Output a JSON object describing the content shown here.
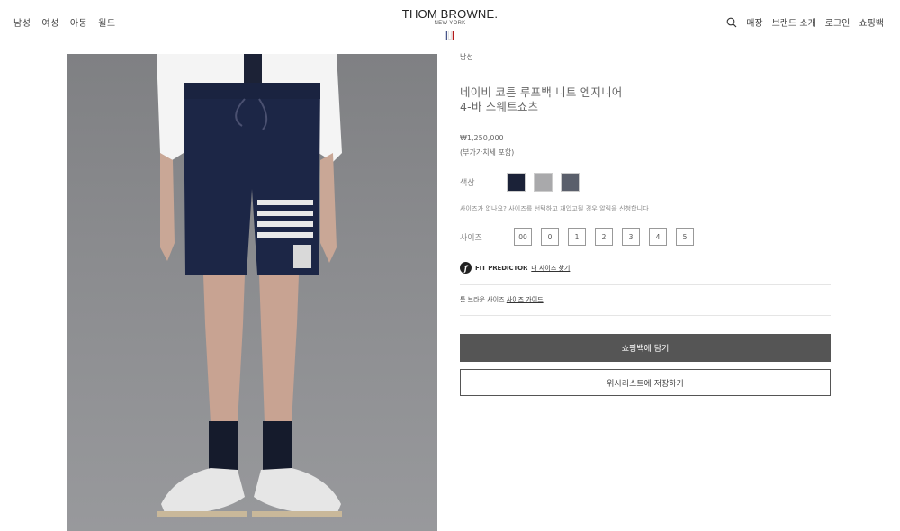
{
  "nav_left": [
    "남성",
    "여성",
    "아동",
    "월드"
  ],
  "logo": {
    "main": "THOM BROWNE.",
    "sub": "NEW YORK"
  },
  "flag_colors": [
    "#1a2a6c",
    "#ffffff",
    "#b31b1b"
  ],
  "nav_right": {
    "search_icon": "search-icon",
    "store": "매장",
    "brand": "브랜드 소개",
    "login": "로그인",
    "bag": "쇼핑백"
  },
  "product": {
    "category": "남성",
    "title": "네이비 코튼 루프백 니트 엔지니어 4-바 스웨트쇼츠",
    "price": "₩1,250,000",
    "vat": "(부가가치세 포함)",
    "color_label": "색상",
    "colors": [
      "#1b2238",
      "#a9a9ab",
      "#5a5f6b"
    ],
    "notify_text": "사이즈가 없나요? 사이즈를 선택하고 재입고될 경우 알림을 신청합니다",
    "size_label": "사이즈",
    "sizes": [
      "00",
      "0",
      "1",
      "2",
      "3",
      "4",
      "5"
    ],
    "fit_predictor_label": "FIT PREDICTOR",
    "fit_predictor_link": "내 사이즈 찾기",
    "seen_prefix": "톰 브라운 사이즈",
    "seen_link": "사이즈 가이드",
    "add_to_bag": "쇼핑백에 담기",
    "wishlist": "위시리스트에 저장하기"
  }
}
